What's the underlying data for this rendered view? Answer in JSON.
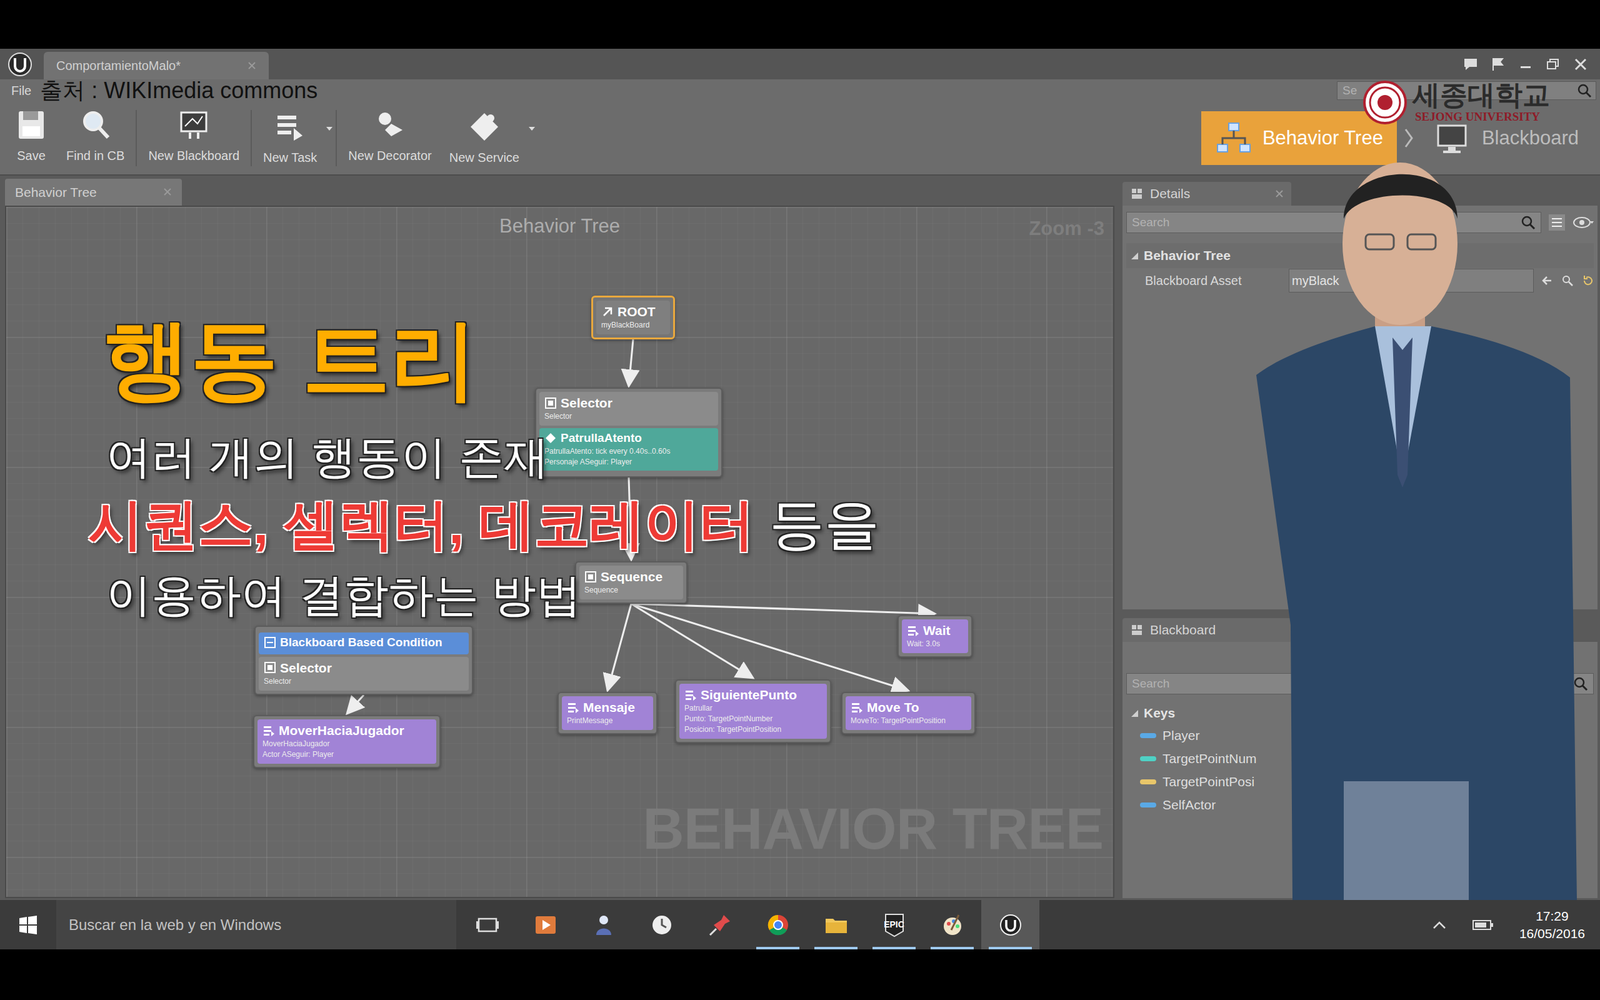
{
  "window": {
    "tab": "ComportamientoMalo*",
    "menu": [
      "File"
    ],
    "help_search": {
      "placeholder": "Se"
    }
  },
  "credit": "출처 : WIKImedia commons",
  "university": {
    "name": "세종대학교",
    "name_en": "SEJONG UNIVERSITY"
  },
  "toolbar": {
    "buttons": [
      {
        "label": "Save",
        "kind": "save",
        "dropdown": false
      },
      {
        "label": "Find in CB",
        "kind": "find",
        "dropdown": false
      },
      {
        "label": "New Blackboard",
        "kind": "blackboard",
        "dropdown": false
      },
      {
        "label": "New Task",
        "kind": "task",
        "dropdown": true
      },
      {
        "label": "New Decorator",
        "kind": "decorator",
        "dropdown": false
      },
      {
        "label": "New Service",
        "kind": "service",
        "dropdown": true
      }
    ],
    "modes": [
      {
        "label": "Behavior Tree",
        "selected": true
      },
      {
        "label": "Blackboard",
        "selected": false
      }
    ]
  },
  "editor": {
    "tab": "Behavior Tree"
  },
  "graph": {
    "title": "Behavior Tree",
    "zoom": "Zoom -3",
    "watermark": "BEHAVIOR TREE",
    "nodes": [
      {
        "kind": "root",
        "title": "ROOT",
        "lines": [
          "myBlackBoard"
        ],
        "attachments": []
      },
      {
        "kind": "composite",
        "title": "Selector",
        "lines": [
          "Selector"
        ],
        "attachments": [
          {
            "kind": "service",
            "title": "PatrullaAtento",
            "lines": [
              "PatrullaAtento: tick every 0.40s..0.60s",
              "Personaje ASeguir: Player"
            ],
            "color": "#4fa89a"
          }
        ]
      },
      {
        "kind": "composite",
        "title": "Sequence",
        "lines": [
          "Sequence"
        ],
        "attachments": []
      },
      {
        "kind": "composite",
        "title": "Selector",
        "lines": [
          "Selector"
        ],
        "attachments": [
          {
            "kind": "decorator",
            "title": "Blackboard Based Condition",
            "lines": [],
            "color": "#5b8ed8"
          }
        ]
      },
      {
        "kind": "task",
        "title": "MoverHaciaJugador",
        "lines": [
          "MoverHaciaJugador",
          "Actor ASeguir: Player"
        ],
        "attachments": []
      },
      {
        "kind": "task",
        "title": "Mensaje",
        "lines": [
          "PrintMessage"
        ],
        "attachments": []
      },
      {
        "kind": "task",
        "title": "SiguientePunto",
        "lines": [
          "Patrullar",
          "Punto: TargetPointNumber",
          "Posicion: TargetPointPosition"
        ],
        "attachments": []
      },
      {
        "kind": "task",
        "title": "Move To",
        "lines": [
          "MoveTo: TargetPointPosition"
        ],
        "attachments": []
      },
      {
        "kind": "task",
        "title": "Wait",
        "lines": [
          "Wait: 3.0s"
        ],
        "attachments": []
      }
    ],
    "edges": [
      [
        0,
        1
      ],
      [
        1,
        2
      ],
      [
        2,
        5
      ],
      [
        2,
        6
      ],
      [
        2,
        7
      ],
      [
        2,
        8
      ],
      [
        3,
        4
      ]
    ]
  },
  "overlay": {
    "title": "행동 트리",
    "lines": [
      [
        {
          "text": "여러 개의 행동이 존재",
          "emphasis": false
        }
      ],
      [
        {
          "text": "시퀀스, 셀렉터, 데코레이터",
          "emphasis": true
        },
        {
          "text": " 등을",
          "emphasis": false
        }
      ],
      [
        {
          "text": "이용하여 결합하는 방법",
          "emphasis": false
        }
      ]
    ]
  },
  "details": {
    "title": "Details",
    "search": {
      "placeholder": "Search"
    },
    "section": "Behavior Tree",
    "expanded": true,
    "properties": [
      {
        "label": "Blackboard Asset",
        "value": "myBlack"
      }
    ]
  },
  "blackboard": {
    "title": "Blackboard",
    "search": {
      "placeholder": "Search"
    },
    "group": "Keys",
    "expanded": true,
    "keys": [
      {
        "name": "Player",
        "color": "#5aa9e6"
      },
      {
        "name": "TargetPointNum",
        "color": "#4fd1c5"
      },
      {
        "name": "TargetPointPosi",
        "color": "#e8c66a"
      },
      {
        "name": "SelfActor",
        "color": "#5aa9e6"
      }
    ]
  },
  "taskbar": {
    "search": "Buscar en la web y en Windows",
    "apps": [
      {
        "kind": "task-view",
        "running": false,
        "selected": false
      },
      {
        "kind": "media",
        "running": false,
        "selected": false
      },
      {
        "kind": "people",
        "running": false,
        "selected": false
      },
      {
        "kind": "clock",
        "running": false,
        "selected": false
      },
      {
        "kind": "pin",
        "running": false,
        "selected": false
      },
      {
        "kind": "chrome",
        "running": true,
        "selected": false
      },
      {
        "kind": "folder",
        "running": true,
        "selected": false
      },
      {
        "kind": "epic",
        "label": "EPIC",
        "running": true,
        "selected": false
      },
      {
        "kind": "paint",
        "running": true,
        "selected": false
      },
      {
        "kind": "unreal",
        "running": true,
        "selected": true
      }
    ],
    "time": "17:29",
    "date": "16/05/2016"
  }
}
